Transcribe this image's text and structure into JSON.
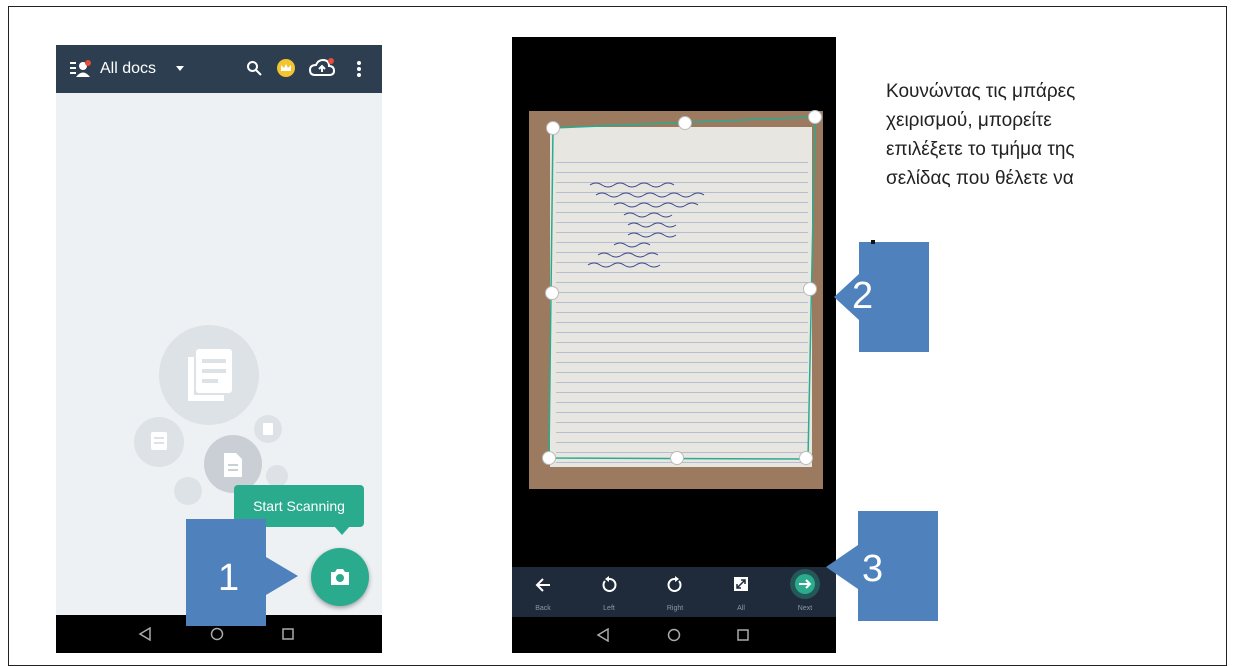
{
  "phone1": {
    "app_bar": {
      "title": "All docs",
      "icons": [
        "people-icon",
        "search-icon",
        "crown-badge-icon",
        "cloud-upload-icon",
        "more-vert-icon"
      ],
      "accent": "#2c3e50"
    },
    "tooltip_label": "Start Scanning",
    "accent": "#2bab8e",
    "fab_icon": "camera-icon",
    "nav_icons": [
      "back-triangle-icon",
      "home-circle-icon",
      "recents-square-icon"
    ]
  },
  "phone2": {
    "toolbar": {
      "items": [
        {
          "label": "Back",
          "icon": "arrow-left-icon"
        },
        {
          "label": "Left",
          "icon": "rotate-left-icon"
        },
        {
          "label": "Right",
          "icon": "rotate-right-icon"
        },
        {
          "label": "All",
          "icon": "expand-icon"
        },
        {
          "label": "Next",
          "icon": "arrow-right-circle-icon"
        }
      ]
    },
    "crop_color": "#2bab8e",
    "nav_icons": [
      "back-triangle-icon",
      "home-circle-icon",
      "recents-square-icon"
    ]
  },
  "callouts": [
    {
      "number": "1"
    },
    {
      "number": "2"
    },
    {
      "number": "3"
    }
  ],
  "callout_color": "#4f81bd",
  "description": {
    "lines": [
      "Κουνώντας τις μπάρες",
      "χειρισμού, μπορείτε",
      "επιλέξετε το τμήμα της",
      "σελίδας που θέλετε να"
    ]
  }
}
